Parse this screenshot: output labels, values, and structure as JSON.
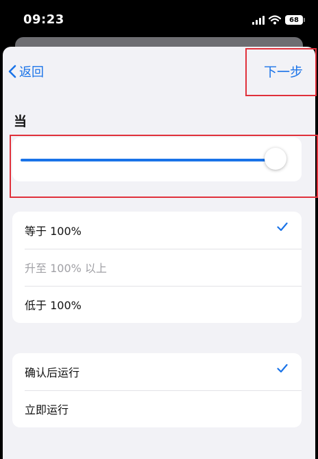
{
  "status_bar": {
    "time": "09:23",
    "battery": "68"
  },
  "nav": {
    "back_label": "返回",
    "next_label": "下一步"
  },
  "section": {
    "title": "当"
  },
  "slider": {
    "value_fraction": 0.98
  },
  "threshold_options": [
    {
      "label": "等于 100%",
      "selected": true,
      "enabled": true
    },
    {
      "label": "升至 100% 以上",
      "selected": false,
      "enabled": false
    },
    {
      "label": "低于 100%",
      "selected": false,
      "enabled": true
    }
  ],
  "run_options": [
    {
      "label": "确认后运行",
      "selected": true
    },
    {
      "label": "立即运行",
      "selected": false
    }
  ],
  "colors": {
    "accent": "#1a73e8",
    "highlight_box": "#e0303a"
  }
}
